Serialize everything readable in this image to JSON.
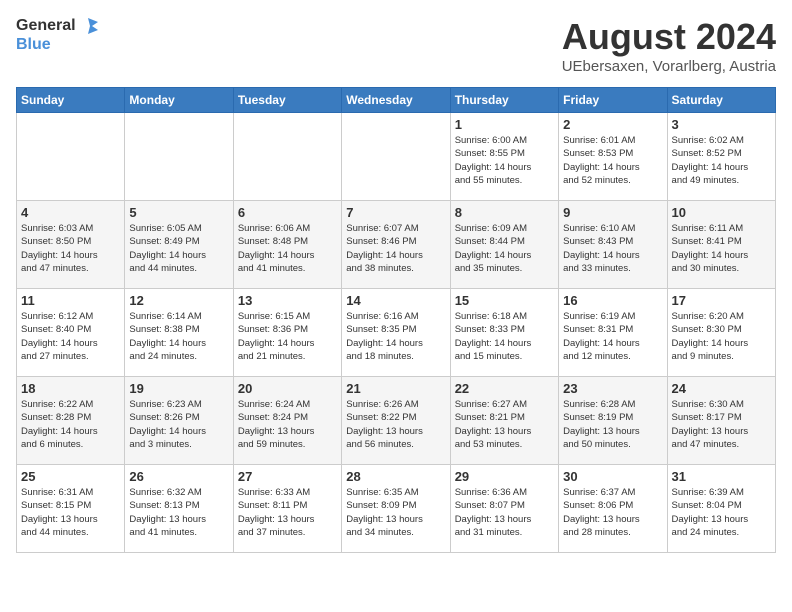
{
  "header": {
    "logo_line1": "General",
    "logo_line2": "Blue",
    "month_year": "August 2024",
    "location": "UEbersaxen, Vorarlberg, Austria"
  },
  "days_of_week": [
    "Sunday",
    "Monday",
    "Tuesday",
    "Wednesday",
    "Thursday",
    "Friday",
    "Saturday"
  ],
  "weeks": [
    [
      {
        "day": "",
        "info": ""
      },
      {
        "day": "",
        "info": ""
      },
      {
        "day": "",
        "info": ""
      },
      {
        "day": "",
        "info": ""
      },
      {
        "day": "1",
        "info": "Sunrise: 6:00 AM\nSunset: 8:55 PM\nDaylight: 14 hours\nand 55 minutes."
      },
      {
        "day": "2",
        "info": "Sunrise: 6:01 AM\nSunset: 8:53 PM\nDaylight: 14 hours\nand 52 minutes."
      },
      {
        "day": "3",
        "info": "Sunrise: 6:02 AM\nSunset: 8:52 PM\nDaylight: 14 hours\nand 49 minutes."
      }
    ],
    [
      {
        "day": "4",
        "info": "Sunrise: 6:03 AM\nSunset: 8:50 PM\nDaylight: 14 hours\nand 47 minutes."
      },
      {
        "day": "5",
        "info": "Sunrise: 6:05 AM\nSunset: 8:49 PM\nDaylight: 14 hours\nand 44 minutes."
      },
      {
        "day": "6",
        "info": "Sunrise: 6:06 AM\nSunset: 8:48 PM\nDaylight: 14 hours\nand 41 minutes."
      },
      {
        "day": "7",
        "info": "Sunrise: 6:07 AM\nSunset: 8:46 PM\nDaylight: 14 hours\nand 38 minutes."
      },
      {
        "day": "8",
        "info": "Sunrise: 6:09 AM\nSunset: 8:44 PM\nDaylight: 14 hours\nand 35 minutes."
      },
      {
        "day": "9",
        "info": "Sunrise: 6:10 AM\nSunset: 8:43 PM\nDaylight: 14 hours\nand 33 minutes."
      },
      {
        "day": "10",
        "info": "Sunrise: 6:11 AM\nSunset: 8:41 PM\nDaylight: 14 hours\nand 30 minutes."
      }
    ],
    [
      {
        "day": "11",
        "info": "Sunrise: 6:12 AM\nSunset: 8:40 PM\nDaylight: 14 hours\nand 27 minutes."
      },
      {
        "day": "12",
        "info": "Sunrise: 6:14 AM\nSunset: 8:38 PM\nDaylight: 14 hours\nand 24 minutes."
      },
      {
        "day": "13",
        "info": "Sunrise: 6:15 AM\nSunset: 8:36 PM\nDaylight: 14 hours\nand 21 minutes."
      },
      {
        "day": "14",
        "info": "Sunrise: 6:16 AM\nSunset: 8:35 PM\nDaylight: 14 hours\nand 18 minutes."
      },
      {
        "day": "15",
        "info": "Sunrise: 6:18 AM\nSunset: 8:33 PM\nDaylight: 14 hours\nand 15 minutes."
      },
      {
        "day": "16",
        "info": "Sunrise: 6:19 AM\nSunset: 8:31 PM\nDaylight: 14 hours\nand 12 minutes."
      },
      {
        "day": "17",
        "info": "Sunrise: 6:20 AM\nSunset: 8:30 PM\nDaylight: 14 hours\nand 9 minutes."
      }
    ],
    [
      {
        "day": "18",
        "info": "Sunrise: 6:22 AM\nSunset: 8:28 PM\nDaylight: 14 hours\nand 6 minutes."
      },
      {
        "day": "19",
        "info": "Sunrise: 6:23 AM\nSunset: 8:26 PM\nDaylight: 14 hours\nand 3 minutes."
      },
      {
        "day": "20",
        "info": "Sunrise: 6:24 AM\nSunset: 8:24 PM\nDaylight: 13 hours\nand 59 minutes."
      },
      {
        "day": "21",
        "info": "Sunrise: 6:26 AM\nSunset: 8:22 PM\nDaylight: 13 hours\nand 56 minutes."
      },
      {
        "day": "22",
        "info": "Sunrise: 6:27 AM\nSunset: 8:21 PM\nDaylight: 13 hours\nand 53 minutes."
      },
      {
        "day": "23",
        "info": "Sunrise: 6:28 AM\nSunset: 8:19 PM\nDaylight: 13 hours\nand 50 minutes."
      },
      {
        "day": "24",
        "info": "Sunrise: 6:30 AM\nSunset: 8:17 PM\nDaylight: 13 hours\nand 47 minutes."
      }
    ],
    [
      {
        "day": "25",
        "info": "Sunrise: 6:31 AM\nSunset: 8:15 PM\nDaylight: 13 hours\nand 44 minutes."
      },
      {
        "day": "26",
        "info": "Sunrise: 6:32 AM\nSunset: 8:13 PM\nDaylight: 13 hours\nand 41 minutes."
      },
      {
        "day": "27",
        "info": "Sunrise: 6:33 AM\nSunset: 8:11 PM\nDaylight: 13 hours\nand 37 minutes."
      },
      {
        "day": "28",
        "info": "Sunrise: 6:35 AM\nSunset: 8:09 PM\nDaylight: 13 hours\nand 34 minutes."
      },
      {
        "day": "29",
        "info": "Sunrise: 6:36 AM\nSunset: 8:07 PM\nDaylight: 13 hours\nand 31 minutes."
      },
      {
        "day": "30",
        "info": "Sunrise: 6:37 AM\nSunset: 8:06 PM\nDaylight: 13 hours\nand 28 minutes."
      },
      {
        "day": "31",
        "info": "Sunrise: 6:39 AM\nSunset: 8:04 PM\nDaylight: 13 hours\nand 24 minutes."
      }
    ]
  ]
}
